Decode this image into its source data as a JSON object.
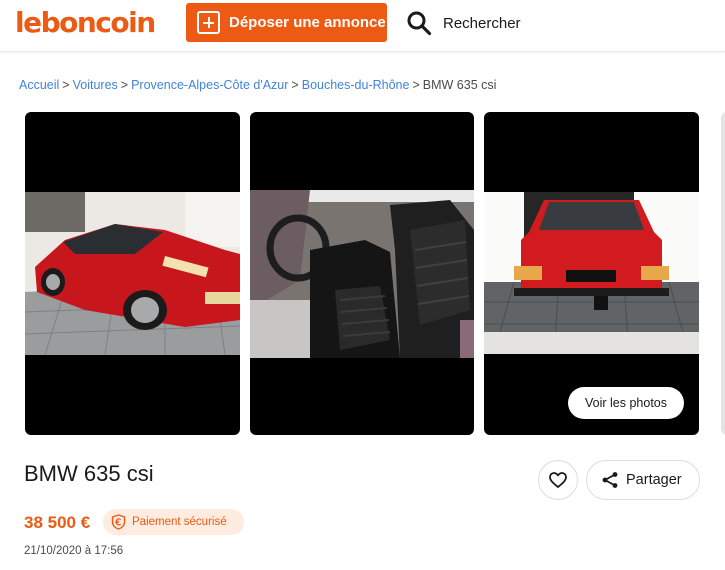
{
  "header": {
    "logo_text": "leboncoin",
    "deposit_label": "Déposer une annonce",
    "search_label": "Rechercher"
  },
  "breadcrumb": {
    "items": [
      "Accueil",
      "Voitures",
      "Provence-Alpes-Côte d'Azur",
      "Bouches-du-Rhône"
    ],
    "separator": ">",
    "current": "BMW 635 csi"
  },
  "gallery": {
    "photos": [
      {
        "name": "car-exterior-front",
        "subject": "red coupe front three-quarter view in garage"
      },
      {
        "name": "car-interior-seats",
        "subject": "black leather seats interior"
      },
      {
        "name": "car-exterior-rear",
        "subject": "red coupe rear view on tiled driveway"
      }
    ],
    "see_photos_label": "Voir les photos"
  },
  "listing": {
    "title": "BMW 635 csi",
    "price": "38 500 €",
    "secure_payment_label": "Paiement sécurisé",
    "date": "21/10/2020 à 17:56",
    "share_label": "Partager"
  },
  "colors": {
    "brand": "#ec5a13",
    "link": "#4183d7",
    "badge_bg": "#fdecdf"
  },
  "icons": [
    "plus-square-icon",
    "search-icon",
    "heart-icon",
    "share-icon",
    "euro-shield-icon"
  ]
}
